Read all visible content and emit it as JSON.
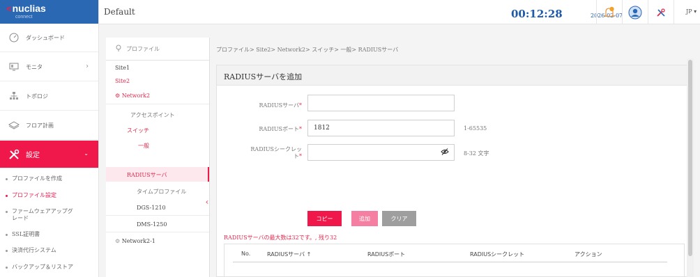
{
  "brand": {
    "name": "nuclias",
    "sub": "connect"
  },
  "header": {
    "site_name": "Default",
    "time": "00:12:28",
    "date": "2026-02-07",
    "language": "JP ▾"
  },
  "sidebar": {
    "items": [
      {
        "label": "ダッシュボード"
      },
      {
        "label": "モニタ"
      },
      {
        "label": "トポロジ"
      },
      {
        "label": "フロア計画"
      },
      {
        "label": "設定"
      }
    ],
    "sub_items": [
      {
        "label": "プロファイルを作成"
      },
      {
        "label": "プロファイル設定"
      },
      {
        "label": "ファームウェアアップグ"
      },
      {
        "label": "レード"
      },
      {
        "label": "SSL証明書"
      },
      {
        "label": "決済代行システム"
      },
      {
        "label": "バックアップ＆リストア"
      }
    ]
  },
  "tree": {
    "header": "プロファイル",
    "rows": [
      {
        "label": "Site1"
      },
      {
        "label": "Site2"
      },
      {
        "label": "Network2"
      },
      {
        "label": "アクセスポイント"
      },
      {
        "label": "スイッチ"
      },
      {
        "label": "一般"
      },
      {
        "label": "RADIUSサーバ"
      },
      {
        "label": "タイムプロファイル"
      },
      {
        "label": "DGS-1210"
      },
      {
        "label": "DMS-1250"
      },
      {
        "label": "Network2-1"
      }
    ]
  },
  "breadcrumb": "プロファイル> Site2> Network2> スイッチ> 一般> RADIUSサーバ",
  "form": {
    "title": "RADIUSサーバを追加",
    "server_label": "RADIUSサーバ",
    "server_value": "",
    "port_label": "RADIUSポート",
    "port_value": "1812",
    "port_hint": "1-65535",
    "secret_label_1": "RADIUSシークレッ",
    "secret_label_2": "ト",
    "secret_value": "",
    "secret_hint": "8-32 文字",
    "required_mark": "*",
    "buttons": {
      "copy": "コピー",
      "add": "追加",
      "clear": "クリア"
    },
    "note": "RADIUSサーバの最大数は32です。, 残り32"
  },
  "table": {
    "columns": [
      "No.",
      "RADIUSサーバ ↑",
      "RADIUSポート",
      "RADIUSシークレット",
      "アクション"
    ]
  },
  "colors": {
    "brand_blue": "#2a68b3",
    "accent_pink": "#f0174b",
    "button_pink_light": "#f47fa2",
    "button_grey": "#9e9e9e"
  }
}
